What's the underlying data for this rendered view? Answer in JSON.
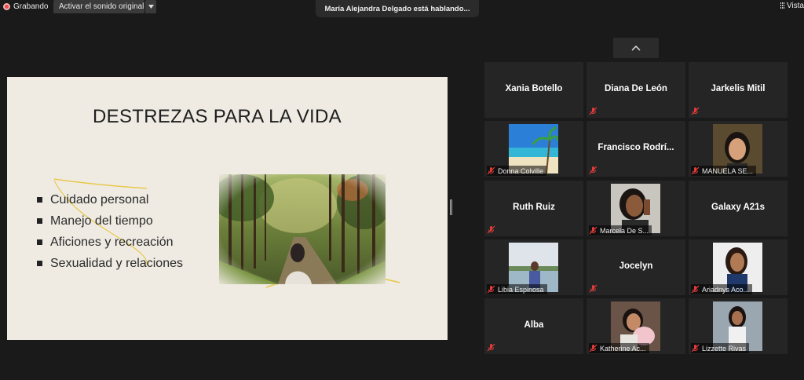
{
  "topbar": {
    "recording_label": "Grabando",
    "original_sound_label": "Activar el sonido original",
    "speaking_notice": "María Alejandra Delgado está hablando...",
    "view_label": "Vista"
  },
  "slide": {
    "title": "DESTREZAS PARA LA VIDA",
    "bullets": [
      "Cuidado personal",
      "Manejo del tiempo",
      "Aficiones y recreación",
      "Sexualidad y relaciones"
    ]
  },
  "gallery": {
    "participants": [
      {
        "name": "Xania Botello",
        "video": false
      },
      {
        "name": "Diana De León",
        "video": false
      },
      {
        "name": "Jarkelis Mitil",
        "video": false
      },
      {
        "name": "Donna Colville",
        "video": true
      },
      {
        "name": "Francisco  Rodrí...",
        "video": false
      },
      {
        "name": "MANUELA SE...",
        "video": true
      },
      {
        "name": "Ruth Ruiz",
        "video": false
      },
      {
        "name": "Marcela De S...",
        "video": true
      },
      {
        "name": "Galaxy A21s",
        "video": false
      },
      {
        "name": "Libia Espinosa",
        "video": true
      },
      {
        "name": "Jocelyn",
        "video": false
      },
      {
        "name": "Ariadnys Aco...",
        "video": true
      },
      {
        "name": "Alba",
        "video": false
      },
      {
        "name": "Katherine Ac...",
        "video": true
      },
      {
        "name": "Lizzette Rivas",
        "video": true
      }
    ]
  },
  "colors": {
    "background": "#1a1a1a",
    "tile": "#252525",
    "mute_red": "#e03c3c",
    "slide_bg": "#efebe3",
    "scribble_yellow": "#e8c84a"
  }
}
